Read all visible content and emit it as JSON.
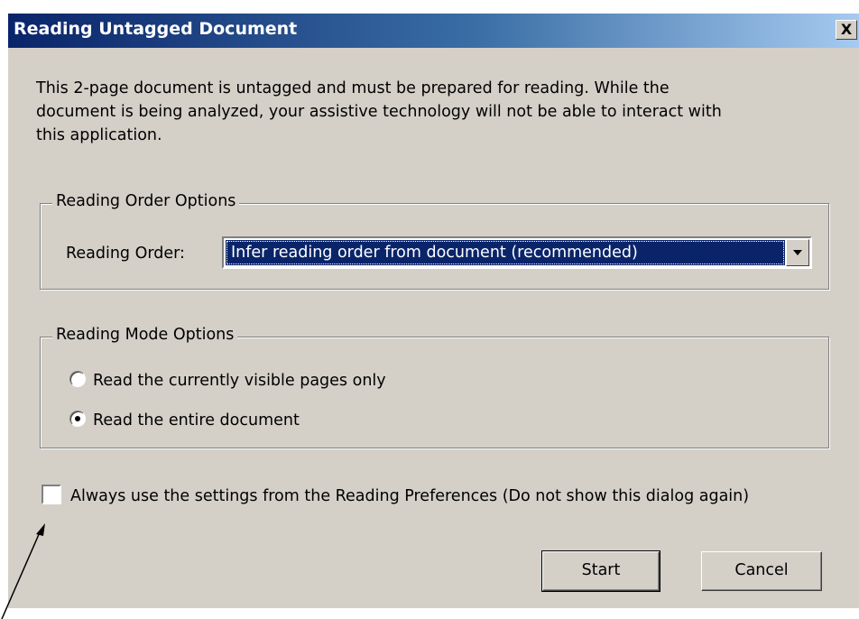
{
  "dialog": {
    "title": "Reading Untagged Document",
    "close_label": "X",
    "intro_lines": [
      "This 2-page document is untagged and must be prepared for reading. While the",
      "document is being analyzed, your assistive technology will not be able to interact with",
      "this application."
    ]
  },
  "reading_order_group": {
    "legend": "Reading Order Options",
    "label": "Reading Order:",
    "selected_value": "Infer reading order from document (recommended)"
  },
  "reading_mode_group": {
    "legend": "Reading Mode Options",
    "options": [
      {
        "label": "Read the currently visible pages only",
        "checked": false
      },
      {
        "label": "Read the entire document",
        "checked": true
      }
    ]
  },
  "always_use_settings": {
    "label": "Always use the settings from the Reading Preferences (Do not show this dialog again)",
    "checked": false
  },
  "buttons": {
    "start_label": "Start",
    "cancel_label": "Cancel"
  },
  "colors": {
    "dialog_bg": "#d4d0c8",
    "titlebar_start": "#0a246a",
    "titlebar_end": "#a6caf0",
    "selection_bg": "#0a246a"
  }
}
